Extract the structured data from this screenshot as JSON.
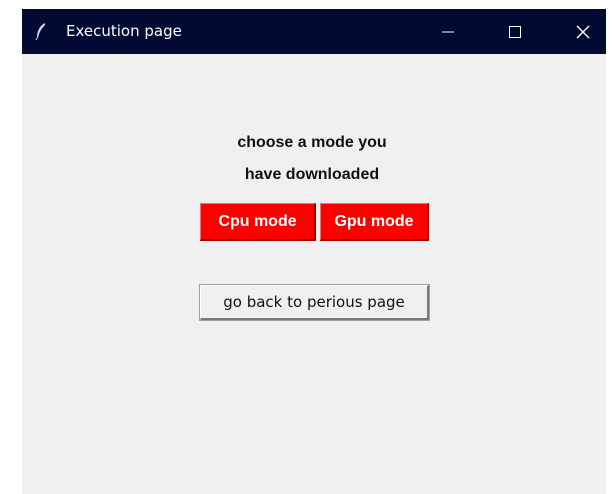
{
  "window": {
    "title": "Execution page",
    "icon": "feather-icon",
    "controls": [
      "minimize-icon",
      "maximize-icon",
      "close-icon"
    ]
  },
  "main": {
    "prompt_line1": "choose a mode you",
    "prompt_line2": "have downloaded",
    "cpu_button_label": "Cpu mode",
    "gpu_button_label": "Gpu mode",
    "back_button_label": "go back to perious page"
  },
  "colors": {
    "titlebar": "#020a33",
    "mode_button": "#ff0000",
    "background": "#f0f0f0"
  }
}
